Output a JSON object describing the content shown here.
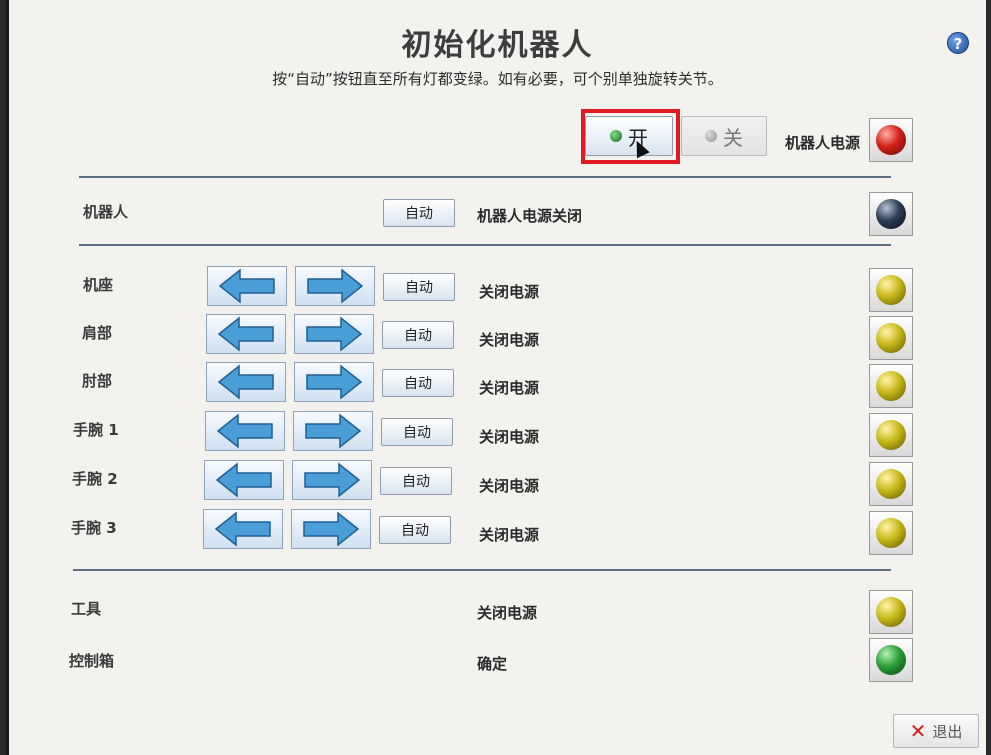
{
  "title": "初始化机器人",
  "subtitle": "按“自动”按钮直至所有灯都变绿。如有必要，可个别单独旋转关节。",
  "help_label": "?",
  "power": {
    "on_label": "开",
    "off_label": "关",
    "label": "机器人电源",
    "lamp_color": "red"
  },
  "robot_row": {
    "label": "机器人",
    "auto_label": "自动",
    "status": "机器人电源关闭",
    "lamp_color": "dark"
  },
  "joints": [
    {
      "label": "机座",
      "auto_label": "自动",
      "status": "关闭电源",
      "lamp_color": "yellow"
    },
    {
      "label": "肩部",
      "auto_label": "自动",
      "status": "关闭电源",
      "lamp_color": "yellow"
    },
    {
      "label": "肘部",
      "auto_label": "自动",
      "status": "关闭电源",
      "lamp_color": "yellow"
    },
    {
      "label": "手腕 1",
      "auto_label": "自动",
      "status": "关闭电源",
      "lamp_color": "yellow"
    },
    {
      "label": "手腕 2",
      "auto_label": "自动",
      "status": "关闭电源",
      "lamp_color": "yellow"
    },
    {
      "label": "手腕 3",
      "auto_label": "自动",
      "status": "关闭电源",
      "lamp_color": "yellow"
    }
  ],
  "tool": {
    "label": "工具",
    "status": "关闭电源",
    "lamp_color": "yellow"
  },
  "control_box": {
    "label": "控制箱",
    "status": "确定",
    "lamp_color": "green"
  },
  "exit_label": "退出",
  "colors": {
    "highlight": "#e01b24",
    "arrow": "#4a9fd8"
  }
}
